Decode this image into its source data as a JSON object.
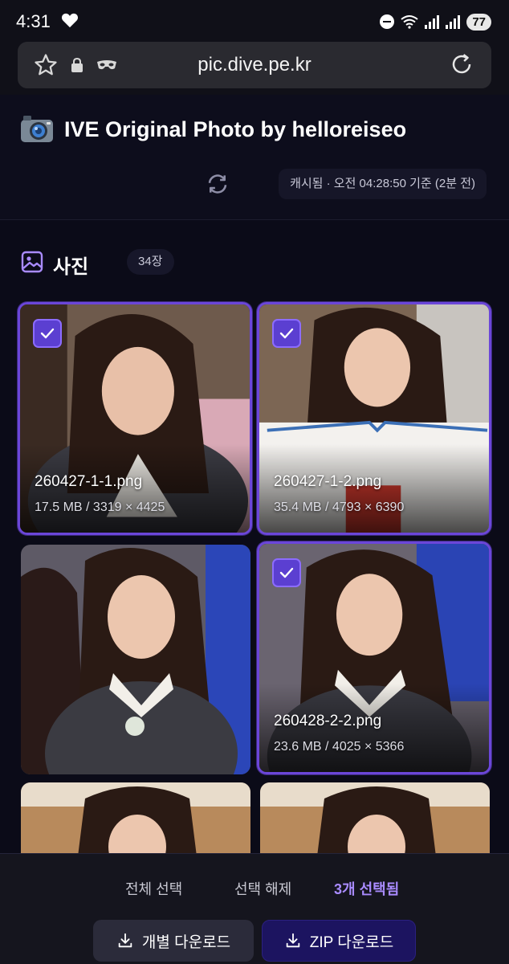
{
  "status_bar": {
    "time": "4:31",
    "battery": "77"
  },
  "browser": {
    "url": "pic.dive.pe.kr"
  },
  "header": {
    "title": "IVE Original Photo by helloreiseo",
    "cache_status": "캐시됨 · 오전 04:28:50 기준 (2분 전)"
  },
  "section": {
    "title": "사진",
    "count": "34장"
  },
  "photos": [
    {
      "filename": "260427-1-1.png",
      "meta": "17.5 MB / 3319 × 4425",
      "selected": true
    },
    {
      "filename": "260427-1-2.png",
      "meta": "35.4 MB / 4793 × 6390",
      "selected": true
    },
    {
      "filename": "",
      "meta": "",
      "selected": false
    },
    {
      "filename": "260428-2-2.png",
      "meta": "23.6 MB / 4025 × 5366",
      "selected": true
    },
    {
      "filename": "",
      "meta": "",
      "selected": false
    },
    {
      "filename": "",
      "meta": "",
      "selected": false
    }
  ],
  "bottom_bar": {
    "select_all": "전체 선택",
    "deselect": "선택 해제",
    "selected_count": "3개 선택됨",
    "individual_download": "개별 다운로드",
    "zip_download": "ZIP 다운로드"
  },
  "colors": {
    "accent": "#6b46d9",
    "selected_text": "#a98bff",
    "background": "#0b0b18"
  }
}
